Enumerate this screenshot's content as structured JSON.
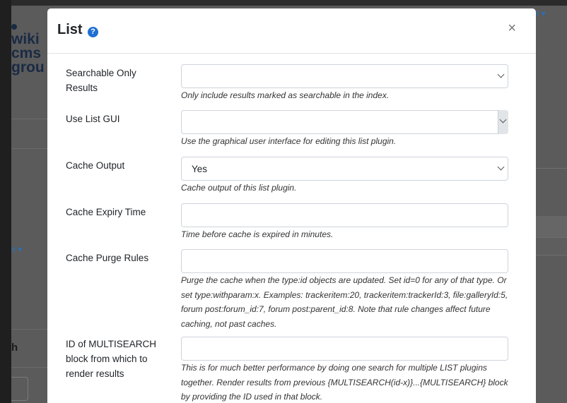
{
  "background": {
    "logo_lines": [
      "wiki",
      "cms",
      "grou"
    ],
    "left_link": "s ▾",
    "left_text": "h",
    "top_caret": "t ▾"
  },
  "modal": {
    "title": "List",
    "help_icon": "?",
    "close_label": "×",
    "fields": [
      {
        "label": "Searchable Only Results",
        "value": "",
        "type": "select",
        "hint": "Only include results marked as searchable in the index."
      },
      {
        "label": "Use List GUI",
        "value": "",
        "type": "select-focused",
        "hint": "Use the graphical user interface for editing this list plugin."
      },
      {
        "label": "Cache Output",
        "value": "Yes",
        "type": "select",
        "hint": "Cache output of this list plugin."
      },
      {
        "label": "Cache Expiry Time",
        "value": "",
        "type": "text",
        "hint": "Time before cache is expired in minutes."
      },
      {
        "label": "Cache Purge Rules",
        "value": "",
        "type": "text",
        "hint": "Purge the cache when the type:id objects are updated. Set id=0 for any of that type. Or set type:withparam:x. Examples: trackeritem:20, trackeritem:trackerId:3, file:galleryId:5, forum post:forum_id:7, forum post:parent_id:8. Note that rule changes affect future caching, not past caches."
      },
      {
        "label": "ID of MULTISEARCH block from which to render results",
        "value": "",
        "type": "text",
        "hint": "This is for much better performance by doing one search for multiple LIST plugins together. Render results from previous {MULTISEARCH(id-x)}...{MULTISEARCH} block by providing the ID used in that block."
      }
    ]
  }
}
